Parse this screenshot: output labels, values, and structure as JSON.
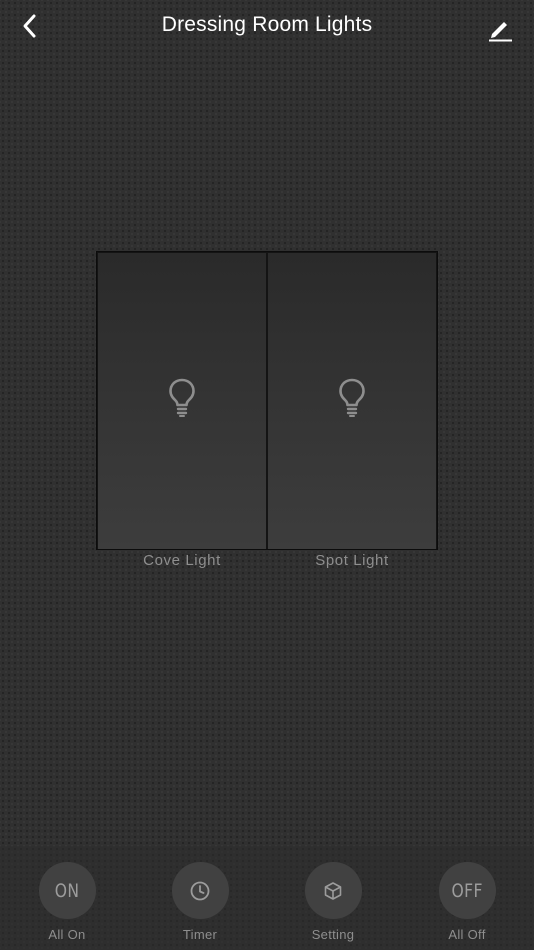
{
  "header": {
    "title": "Dressing Room Lights",
    "back_icon": "chevron-left-icon",
    "edit_icon": "pencil-icon"
  },
  "switches": [
    {
      "label": "Cove Light",
      "icon": "lightbulb-icon",
      "state": "off"
    },
    {
      "label": "Spot Light",
      "icon": "lightbulb-icon",
      "state": "off"
    }
  ],
  "actions": {
    "all_on": {
      "label": "All On",
      "icon_text": "ON"
    },
    "timer": {
      "label": "Timer",
      "icon": "clock-icon"
    },
    "setting": {
      "label": "Setting",
      "icon": "cube-icon"
    },
    "all_off": {
      "label": "All Off",
      "icon_text": "OFF"
    }
  },
  "colors": {
    "background": "#303030",
    "text_primary": "#ffffff",
    "text_muted": "#8e8e8e",
    "icon_gray": "#9c9c9c"
  }
}
